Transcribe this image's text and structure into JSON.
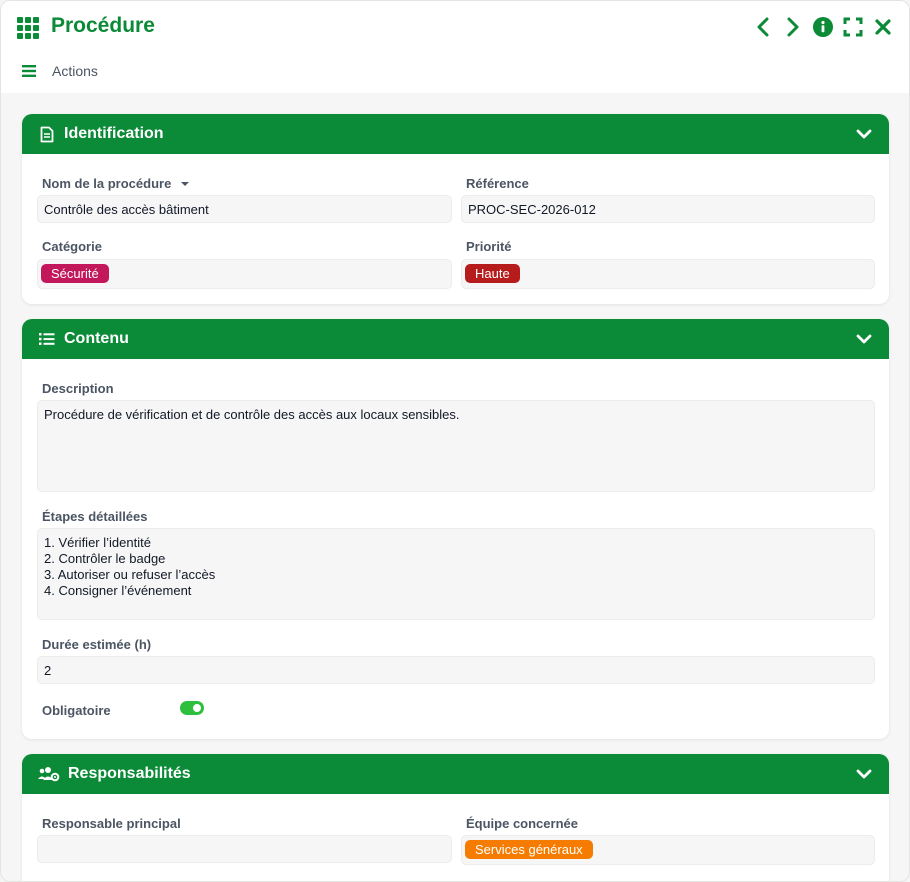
{
  "header": {
    "title": "Procédure",
    "actions_label": "Actions"
  },
  "identification": {
    "title": "Identification",
    "nom_label": "Nom de la procédure",
    "nom_value": "Contrôle des accès bâtiment",
    "reference_label": "Référence",
    "reference_value": "PROC-SEC-2026-012",
    "categorie_label": "Catégorie",
    "categorie_tag": "Sécurité",
    "priorite_label": "Priorité",
    "priorite_tag": "Haute"
  },
  "contenu": {
    "title": "Contenu",
    "description_label": "Description",
    "description_value": "Procédure de vérification et de contrôle des accès aux locaux sensibles.",
    "etapes_label": "Étapes détaillées",
    "etapes_value": "1. Vérifier l’identité\n2. Contrôler le badge\n3. Autoriser ou refuser l’accès\n4. Consigner l’événement",
    "duree_label": "Durée estimée (h)",
    "duree_value": "2",
    "obligatoire_label": "Obligatoire",
    "obligatoire_on": true
  },
  "responsabilites": {
    "title": "Responsabilités",
    "responsable_label": "Responsable principal",
    "responsable_value": "",
    "equipe_label": "Équipe concernée",
    "equipe_tag": "Services généraux"
  },
  "colors": {
    "brand": "#0b8a37",
    "tag_securite": "#c2185b",
    "tag_haute": "#b71c1c",
    "tag_services": "#f57c00",
    "toggle_on": "#2fbf3f"
  }
}
